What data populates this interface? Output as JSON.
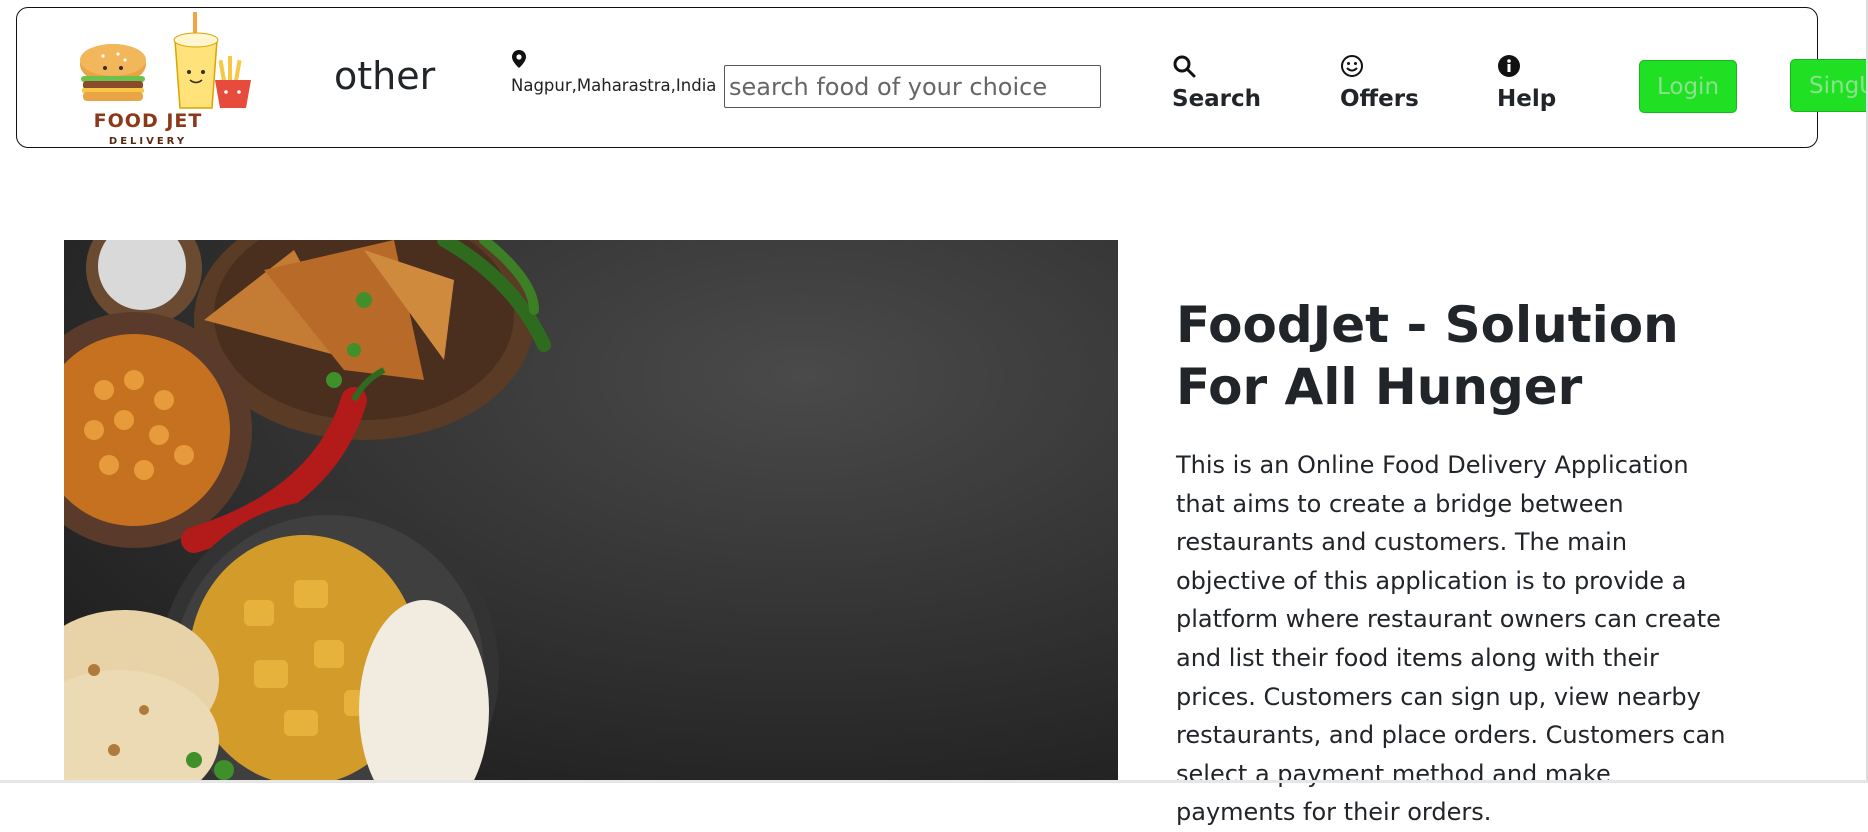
{
  "header": {
    "logo": {
      "line1": "FOOD JET",
      "line2": "DELIVERY",
      "icon": "food-jet-logo"
    },
    "brand_text": "other",
    "location": {
      "icon": "map-pin-icon",
      "text": "Nagpur,Maharastra,India"
    },
    "search": {
      "placeholder": "search food of your choice",
      "value": ""
    },
    "nav": [
      {
        "label": "Search",
        "icon": "search-icon"
      },
      {
        "label": "Offers",
        "icon": "smile-icon"
      },
      {
        "label": "Help",
        "icon": "info-icon"
      }
    ],
    "login_label": "Login",
    "signup_label": "SingUp",
    "button_color": "#1fe022"
  },
  "hero": {
    "image": "indian-food-spread-on-dark-slate",
    "title": "FoodJet - Solution For All Hunger",
    "description": "This is an Online Food Delivery Application that aims to create a bridge between restaurants and customers. The main objective of this application is to provide a platform where restaurant owners can create and list their food items along with their prices. Customers can sign up, view nearby restaurants, and place orders. Customers can select a payment method and make payments for their orders."
  }
}
